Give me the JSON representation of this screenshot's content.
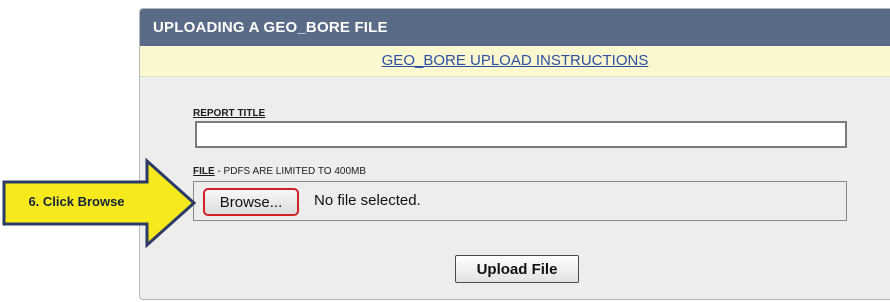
{
  "panel": {
    "header_title": "UPLOADING A GEO_BORE FILE",
    "instructions_link": "GEO_BORE UPLOAD INSTRUCTIONS"
  },
  "form": {
    "report_title_label": "REPORT TITLE",
    "report_title_value": "",
    "file_label": "FILE",
    "file_note": " - PDFS ARE LIMITED TO 400MB",
    "browse_label": "Browse...",
    "file_status": "No file selected.",
    "upload_label": "Upload File"
  },
  "callout": {
    "text": "6. Click Browse"
  },
  "colors": {
    "header_bg": "#5a6b87",
    "instructions_bg": "#fbf8cf",
    "link": "#2c4fa6",
    "panel_bg": "#ededeb",
    "highlight_border": "#d0202a",
    "arrow_fill": "#f6ea1d",
    "arrow_border": "#2b3a67"
  }
}
